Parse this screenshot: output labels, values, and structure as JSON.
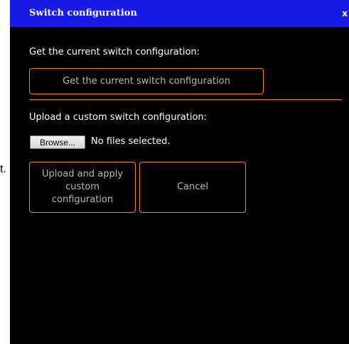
{
  "background": {
    "text": "t."
  },
  "dialog": {
    "title": "Switch configuration",
    "close_label": "x",
    "get_section": {
      "label": "Get the current switch configuration:",
      "button_label": "Get the current switch configuration"
    },
    "upload_section": {
      "label": "Upload a custom switch configuration:",
      "browse_label": "Browse...",
      "file_status": "No files selected.",
      "apply_button_label": "Upload and apply custom configuration",
      "cancel_button_label": "Cancel"
    }
  },
  "colors": {
    "title_bar": "#1a1ae6",
    "dialog_background": "#000000",
    "accent_border": "#e8882a",
    "button_text": "#b8b8b8"
  }
}
